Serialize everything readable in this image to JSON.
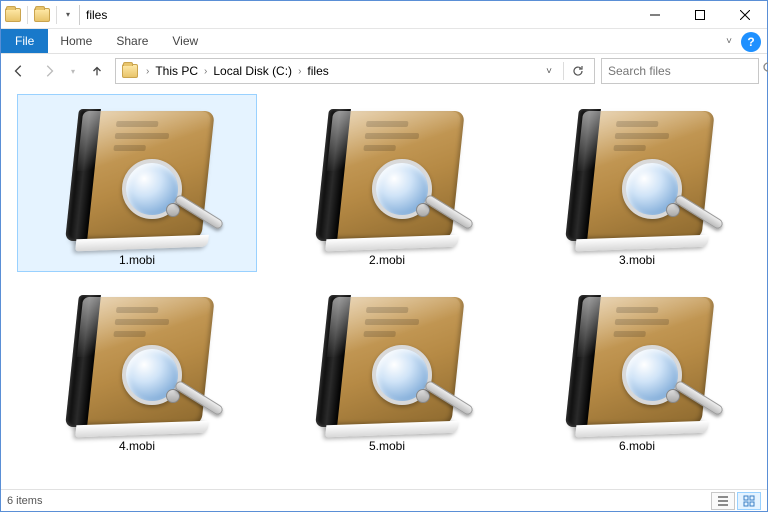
{
  "titlebar": {
    "title": "files"
  },
  "ribbon": {
    "file_label": "File",
    "tabs": [
      "Home",
      "Share",
      "View"
    ]
  },
  "breadcrumb": {
    "items": [
      "This PC",
      "Local Disk (C:)",
      "files"
    ]
  },
  "search": {
    "placeholder": "Search files"
  },
  "files": [
    {
      "name": "1.mobi",
      "selected": true
    },
    {
      "name": "2.mobi",
      "selected": false
    },
    {
      "name": "3.mobi",
      "selected": false
    },
    {
      "name": "4.mobi",
      "selected": false
    },
    {
      "name": "5.mobi",
      "selected": false
    },
    {
      "name": "6.mobi",
      "selected": false
    }
  ],
  "status": {
    "count_text": "6 items"
  },
  "icons": {
    "file_type": "mobi-book-magnifier"
  },
  "colors": {
    "accent": "#1979ca",
    "selection_bg": "#e5f3ff",
    "selection_border": "#99d1ff"
  }
}
